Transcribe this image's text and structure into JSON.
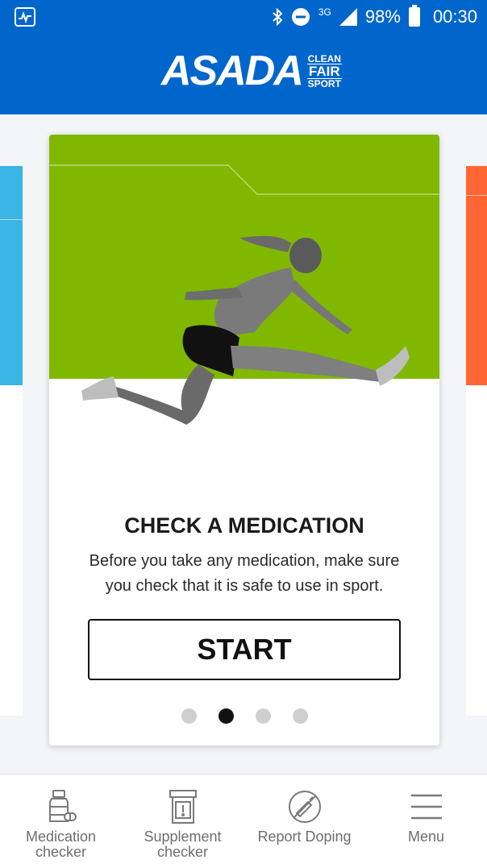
{
  "status_bar": {
    "battery_percent": "98%",
    "time": "00:30",
    "network": "3G",
    "icons": [
      "activity-icon",
      "bluetooth-icon",
      "do-not-disturb-icon",
      "signal-icon",
      "battery-icon"
    ]
  },
  "header": {
    "logo_word": "ASADA",
    "logo_badge": [
      "CLEAN",
      "FAIR",
      "SPORT"
    ]
  },
  "card": {
    "title": "CHECK A MEDICATION",
    "description": "Before you take any medication, make sure you check that it is safe to use in sport.",
    "start_label": "START",
    "pagination": {
      "total": 4,
      "active_index": 1
    }
  },
  "colors": {
    "header_blue": "#0066cc",
    "card_green": "#80b800",
    "left_card_blue": "#3bb4e6",
    "right_card_orange": "#ff6633"
  },
  "bottom_nav": [
    {
      "label": "Medication checker",
      "icon": "medication-bottle-icon"
    },
    {
      "label": "Supplement checker",
      "icon": "supplement-container-icon"
    },
    {
      "label": "Report Doping",
      "icon": "report-doping-icon"
    },
    {
      "label": "Menu",
      "icon": "hamburger-menu-icon"
    }
  ]
}
